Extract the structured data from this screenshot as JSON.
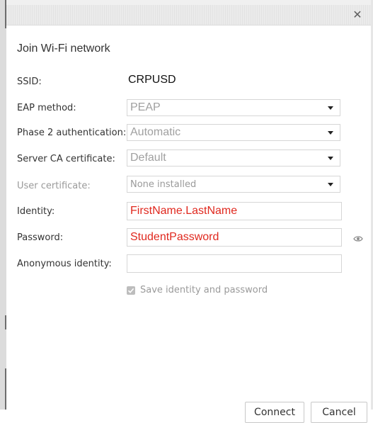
{
  "window": {
    "close_glyph": "✕"
  },
  "dialog": {
    "title": "Join Wi-Fi network",
    "ssid": {
      "label": "SSID:",
      "value": "CRPUSD"
    },
    "eap_method": {
      "label": "EAP method:",
      "value": "PEAP"
    },
    "phase2": {
      "label": "Phase 2 authentication:",
      "value": "Automatic"
    },
    "server_ca": {
      "label": "Server CA certificate:",
      "value": "Default"
    },
    "user_cert": {
      "label": "User certificate:",
      "value": "None installed"
    },
    "identity": {
      "label": "Identity:",
      "value": "FirstName.LastName"
    },
    "password": {
      "label": "Password:",
      "value": "StudentPassword"
    },
    "anonymous_identity": {
      "label": "Anonymous identity:",
      "value": ""
    },
    "save_identity": {
      "label": "Save identity and password",
      "checked": true
    },
    "buttons": {
      "connect": "Connect",
      "cancel": "Cancel"
    }
  },
  "icons": {
    "close": "close-icon",
    "dropdown": "chevron-down-icon",
    "show_password": "eye-icon",
    "checkbox": "checkmark-icon"
  },
  "colors": {
    "entered_text": "#e0281e",
    "disabled_text": "#9a9a9a",
    "border": "#d6d6d6"
  }
}
